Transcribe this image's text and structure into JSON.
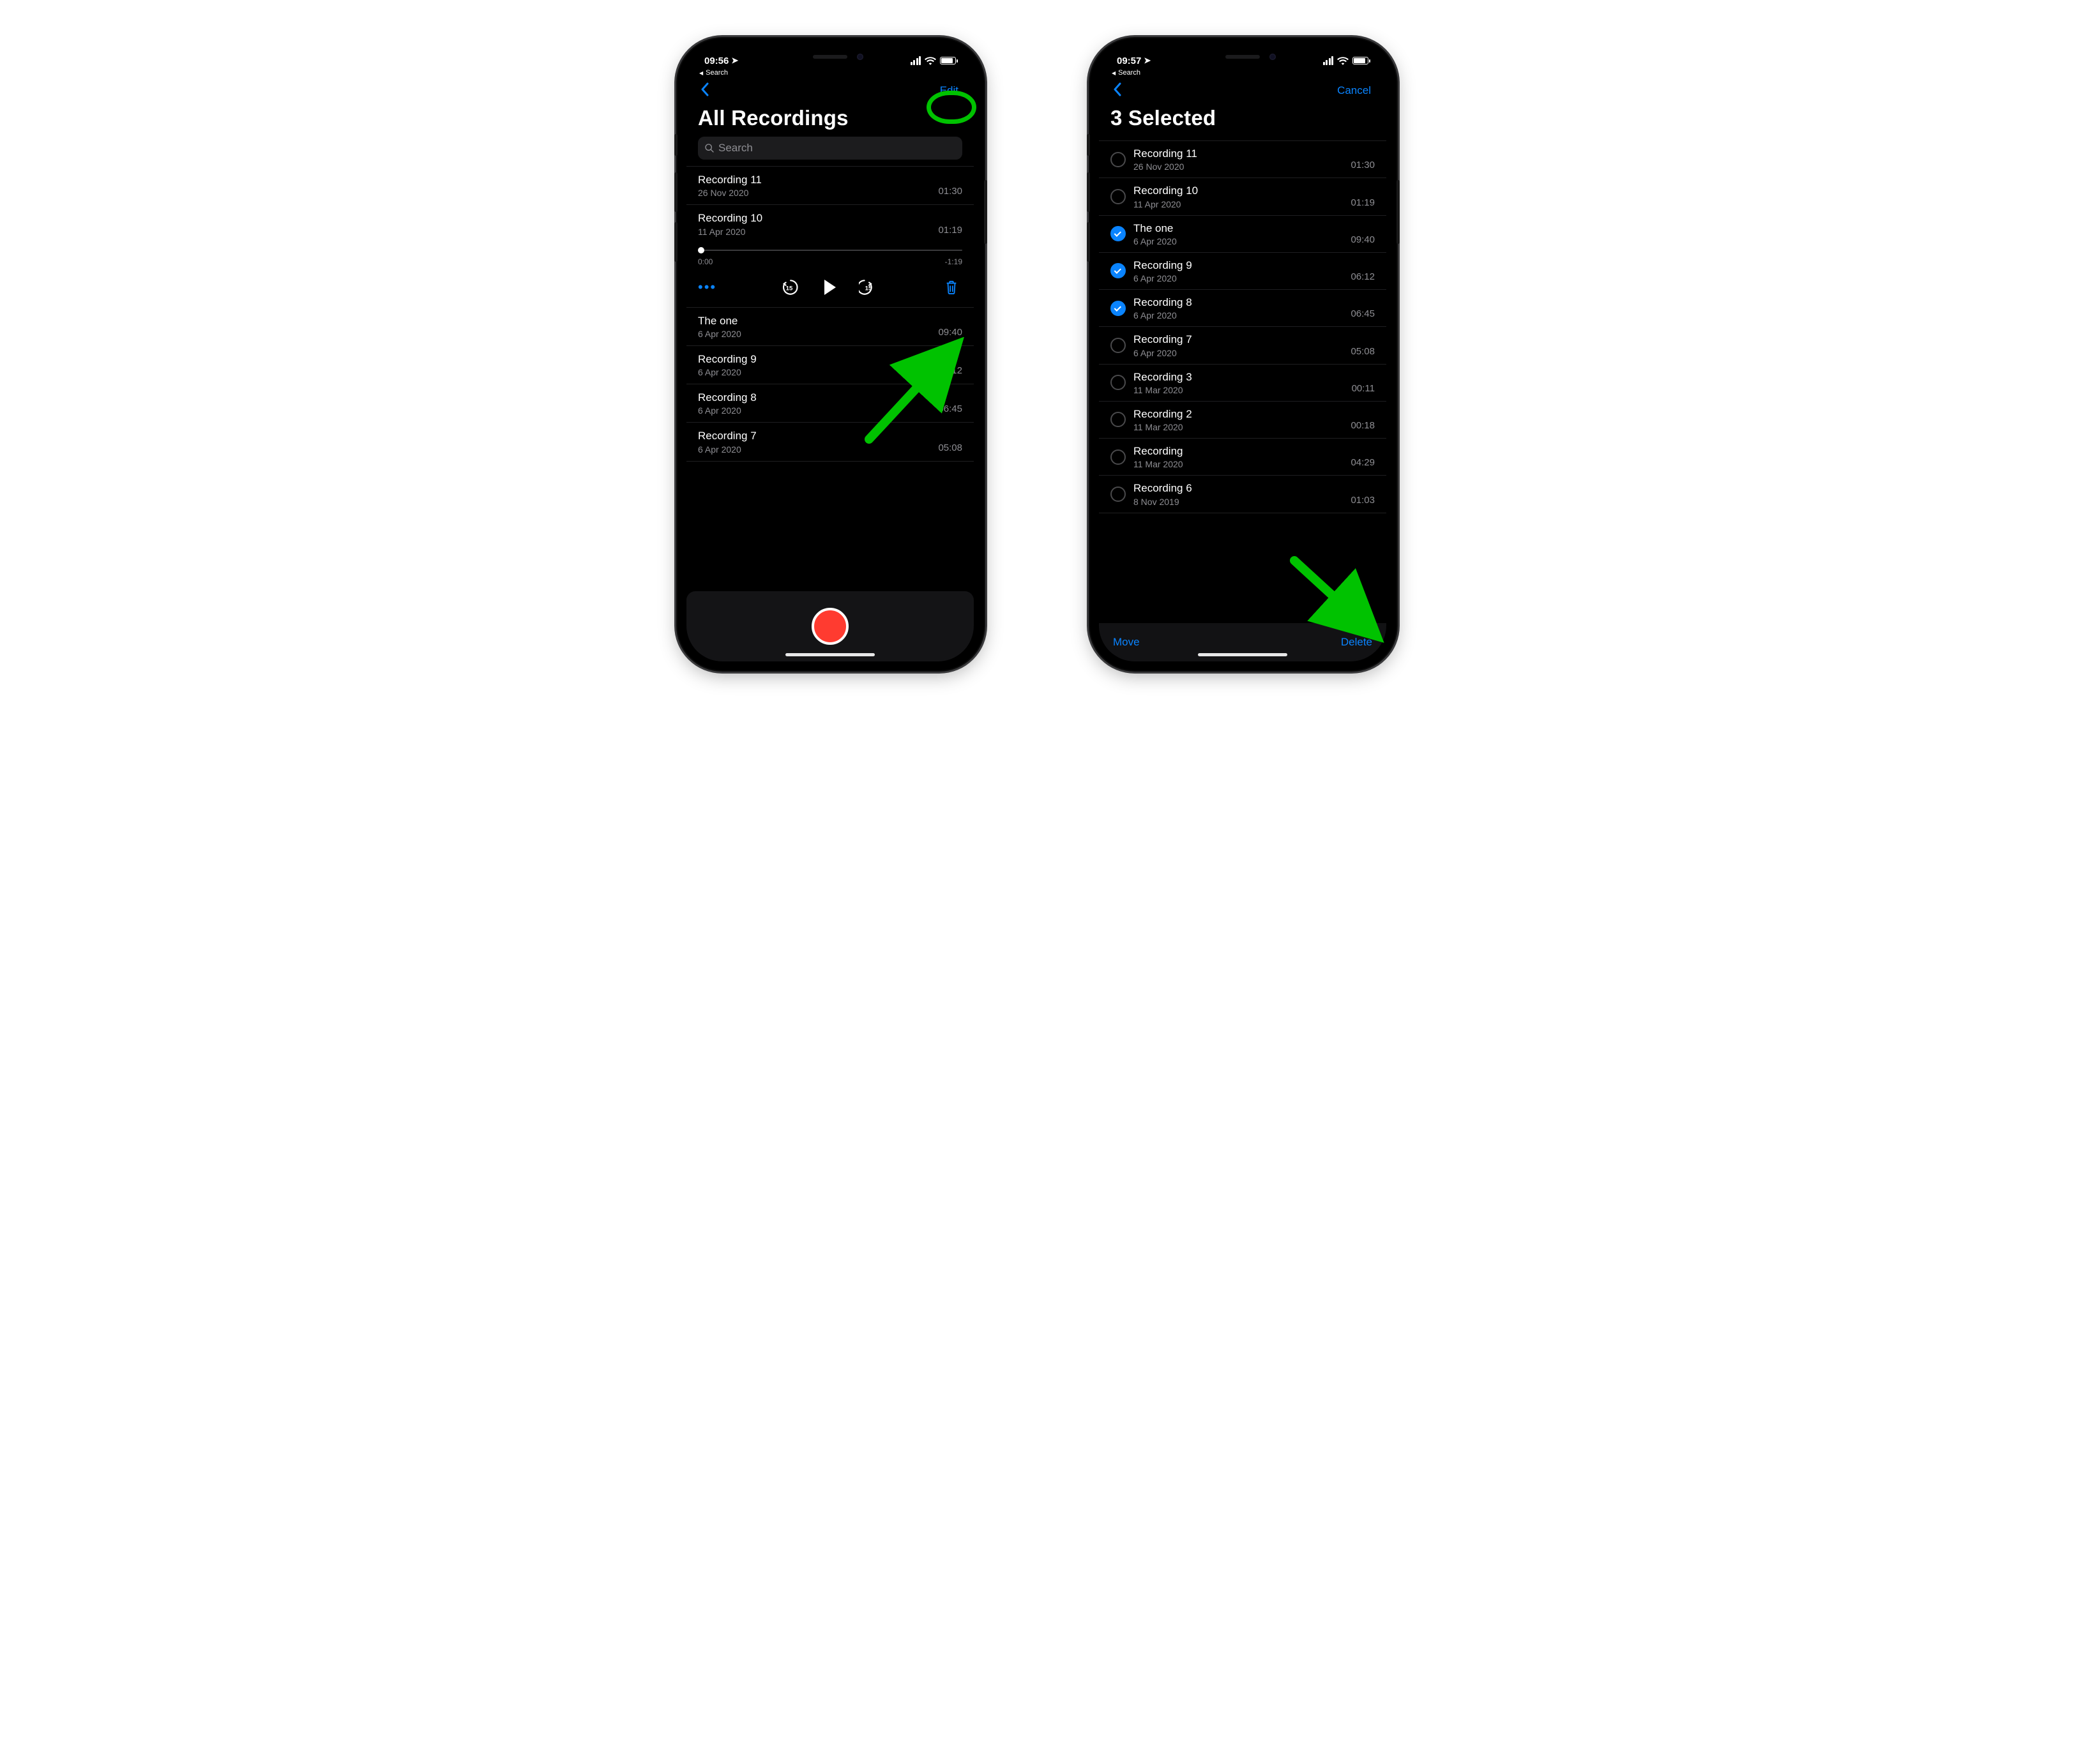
{
  "colors": {
    "accent": "#0a84ff",
    "record": "#ff3b30",
    "annotation": "#00c200"
  },
  "left": {
    "status": {
      "time": "09:56",
      "back_crumb": "Search"
    },
    "nav": {
      "action_label": "Edit"
    },
    "title": "All Recordings",
    "search": {
      "placeholder": "Search"
    },
    "expanded_index": 1,
    "player": {
      "pos_label": "0:00",
      "remain_label": "-1:19"
    },
    "recordings": [
      {
        "title": "Recording 11",
        "date": "26 Nov 2020",
        "duration": "01:30"
      },
      {
        "title": "Recording 10",
        "date": "11 Apr 2020",
        "duration": "01:19"
      },
      {
        "title": "The one",
        "date": "6 Apr 2020",
        "duration": "09:40"
      },
      {
        "title": "Recording 9",
        "date": "6 Apr 2020",
        "duration": "06:12"
      },
      {
        "title": "Recording 8",
        "date": "6 Apr 2020",
        "duration": "06:45"
      },
      {
        "title": "Recording 7",
        "date": "6 Apr 2020",
        "duration": "05:08"
      }
    ]
  },
  "right": {
    "status": {
      "time": "09:57",
      "back_crumb": "Search"
    },
    "nav": {
      "action_label": "Cancel"
    },
    "title": "3 Selected",
    "toolbar": {
      "move_label": "Move",
      "delete_label": "Delete"
    },
    "recordings": [
      {
        "title": "Recording 11",
        "date": "26 Nov 2020",
        "duration": "01:30",
        "selected": false
      },
      {
        "title": "Recording 10",
        "date": "11 Apr 2020",
        "duration": "01:19",
        "selected": false
      },
      {
        "title": "The one",
        "date": "6 Apr 2020",
        "duration": "09:40",
        "selected": true
      },
      {
        "title": "Recording 9",
        "date": "6 Apr 2020",
        "duration": "06:12",
        "selected": true
      },
      {
        "title": "Recording 8",
        "date": "6 Apr 2020",
        "duration": "06:45",
        "selected": true
      },
      {
        "title": "Recording 7",
        "date": "6 Apr 2020",
        "duration": "05:08",
        "selected": false
      },
      {
        "title": "Recording 3",
        "date": "11 Mar 2020",
        "duration": "00:11",
        "selected": false
      },
      {
        "title": "Recording 2",
        "date": "11 Mar 2020",
        "duration": "00:18",
        "selected": false
      },
      {
        "title": "Recording",
        "date": "11 Mar 2020",
        "duration": "04:29",
        "selected": false
      },
      {
        "title": "Recording 6",
        "date": "8 Nov 2019",
        "duration": "01:03",
        "selected": false
      }
    ]
  }
}
